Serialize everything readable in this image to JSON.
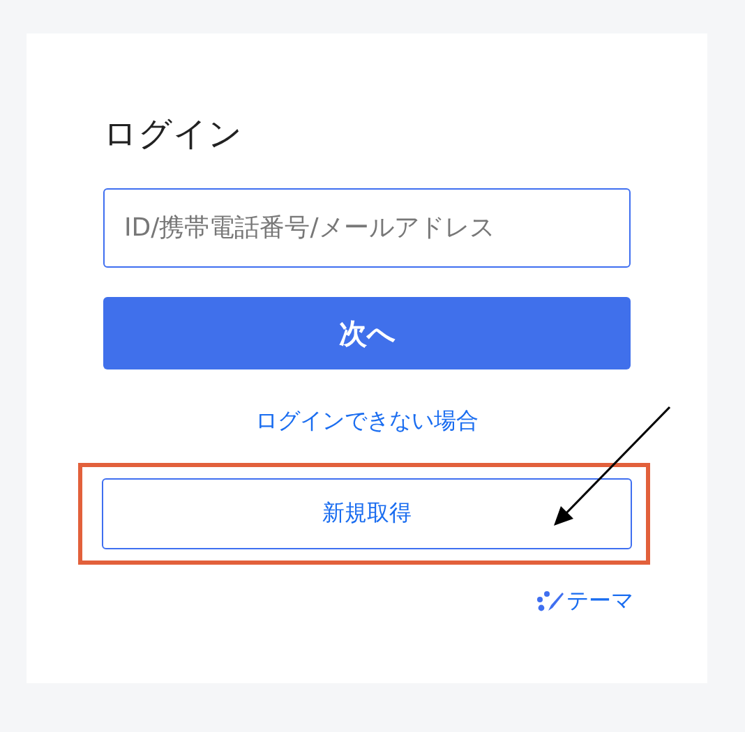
{
  "title": "ログイン",
  "id_field": {
    "placeholder": "ID/携帯電話番号/メールアドレス"
  },
  "next_button": "次へ",
  "help_link": "ログインできない場合",
  "register_button": "新規取得",
  "theme_link": "テーマ"
}
